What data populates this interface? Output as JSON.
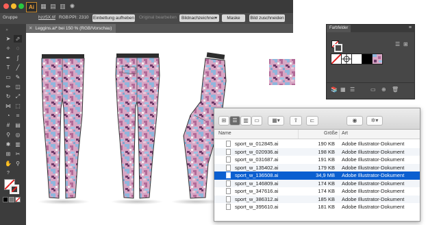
{
  "app": {
    "logo": "Ai"
  },
  "control_bar": {
    "object_type": "Gruppe",
    "file_name": "hzz5X.tif",
    "color_mode": "RGB",
    "ppi": "PPI: 2310",
    "embed_button": "Einbettung aufheben",
    "edit_original": "Original bearbeiten",
    "image_trace": "Bildnachzeichner",
    "mask_button": "Maske",
    "crop_button": "Bild zuschneiden"
  },
  "document": {
    "tab_title": "Leggins.ai* bei 150 % (RGB/Vorschau)"
  },
  "swatches": {
    "title": "Farbfelder"
  },
  "finder": {
    "columns": {
      "name": "Name",
      "size": "Größe",
      "kind": "Art"
    },
    "files": [
      {
        "name": "sport_w_012845.ai",
        "size": "190 KB",
        "kind": "Adobe Illustrator-Dokument"
      },
      {
        "name": "sport_w_020936.ai",
        "size": "198 KB",
        "kind": "Adobe Illustrator-Dokument"
      },
      {
        "name": "sport_w_031687.ai",
        "size": "191 KB",
        "kind": "Adobe Illustrator-Dokument"
      },
      {
        "name": "sport_w_135402.ai",
        "size": "179 KB",
        "kind": "Adobe Illustrator-Dokument"
      },
      {
        "name": "sport_w_136508.ai",
        "size": "34,9 MB",
        "kind": "Adobe Illustrator-Dokument"
      },
      {
        "name": "sport_w_146809.ai",
        "size": "174 KB",
        "kind": "Adobe Illustrator-Dokument"
      },
      {
        "name": "sport_w_347616.ai",
        "size": "174 KB",
        "kind": "Adobe Illustrator-Dokument"
      },
      {
        "name": "sport_w_386312.ai",
        "size": "185 KB",
        "kind": "Adobe Illustrator-Dokument"
      },
      {
        "name": "sport_w_395610.ai",
        "size": "181 KB",
        "kind": "Adobe Illustrator-Dokument"
      }
    ],
    "selected_index": 4
  },
  "icons": {
    "close": "close-icon",
    "minimize": "minimize-icon",
    "zoom": "zoom-icon",
    "finder_view": [
      "icon-view-icon",
      "list-view-icon",
      "column-view-icon",
      "cover-flow-icon"
    ],
    "arrange": "arrange-icon",
    "share": "share-icon",
    "tag": "tag-icon",
    "quicklook": "eye-icon",
    "action": "gear-icon"
  },
  "colors": {
    "selection": "#0b5fd0",
    "ai_orange": "#f0a33a",
    "legging_pink": "#d9a3c1",
    "legging_blue": "#8fb4d8"
  }
}
